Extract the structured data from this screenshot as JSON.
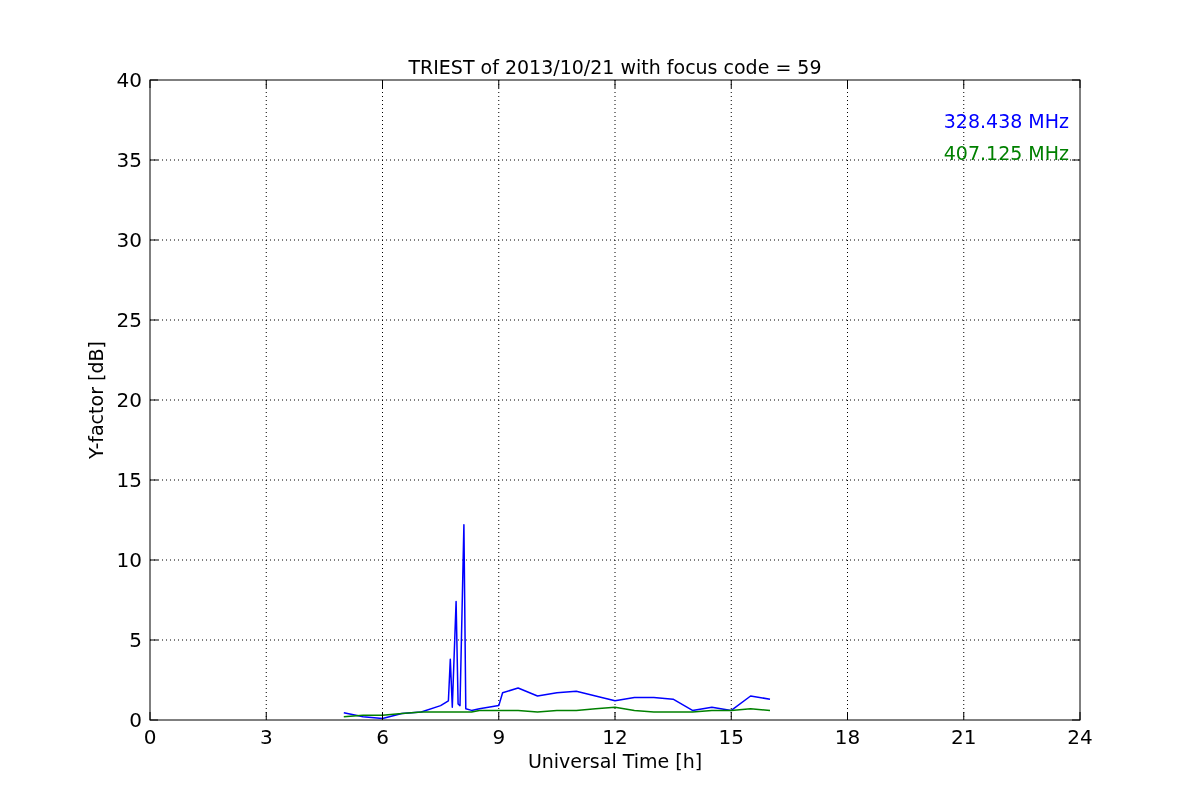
{
  "chart_data": {
    "type": "line",
    "title": "TRIEST of 2013/10/21 with focus code = 59",
    "xlabel": "Universal Time [h]",
    "ylabel": "Y-factor [dB]",
    "x": [
      5,
      5.5,
      6,
      6.5,
      7,
      7.5,
      7.7,
      7.75,
      7.8,
      7.9,
      7.95,
      8.0,
      8.1,
      8.15,
      8.3,
      8.5,
      9,
      9.1,
      9.5,
      10,
      10.5,
      11,
      11.5,
      12,
      12.5,
      13,
      13.5,
      14,
      14.5,
      15,
      15.5,
      16
    ],
    "series": [
      {
        "name": "328.438 MHz",
        "color": "#0000ff",
        "values": [
          0.45,
          0.2,
          0.1,
          0.4,
          0.5,
          0.9,
          1.2,
          3.8,
          0.8,
          7.4,
          1.0,
          0.9,
          12.2,
          0.7,
          0.6,
          0.7,
          0.9,
          1.7,
          2.0,
          1.5,
          1.7,
          1.8,
          1.5,
          1.2,
          1.4,
          1.4,
          1.3,
          0.6,
          0.8,
          0.6,
          1.5,
          1.3
        ]
      },
      {
        "name": "407.125 MHz",
        "color": "#008000",
        "values": [
          0.2,
          0.3,
          0.3,
          0.4,
          0.5,
          0.5,
          0.5,
          0.5,
          0.5,
          0.5,
          0.5,
          0.5,
          0.5,
          0.5,
          0.5,
          0.6,
          0.6,
          0.6,
          0.6,
          0.5,
          0.6,
          0.6,
          0.7,
          0.8,
          0.6,
          0.5,
          0.5,
          0.5,
          0.6,
          0.6,
          0.7,
          0.6
        ]
      }
    ],
    "grid": true,
    "xlim": [
      0,
      24
    ],
    "ylim": [
      0,
      40
    ],
    "xticks": [
      0,
      3,
      6,
      9,
      12,
      15,
      18,
      21,
      24
    ],
    "yticks": [
      0,
      5,
      10,
      15,
      20,
      25,
      30,
      35,
      40
    ]
  }
}
